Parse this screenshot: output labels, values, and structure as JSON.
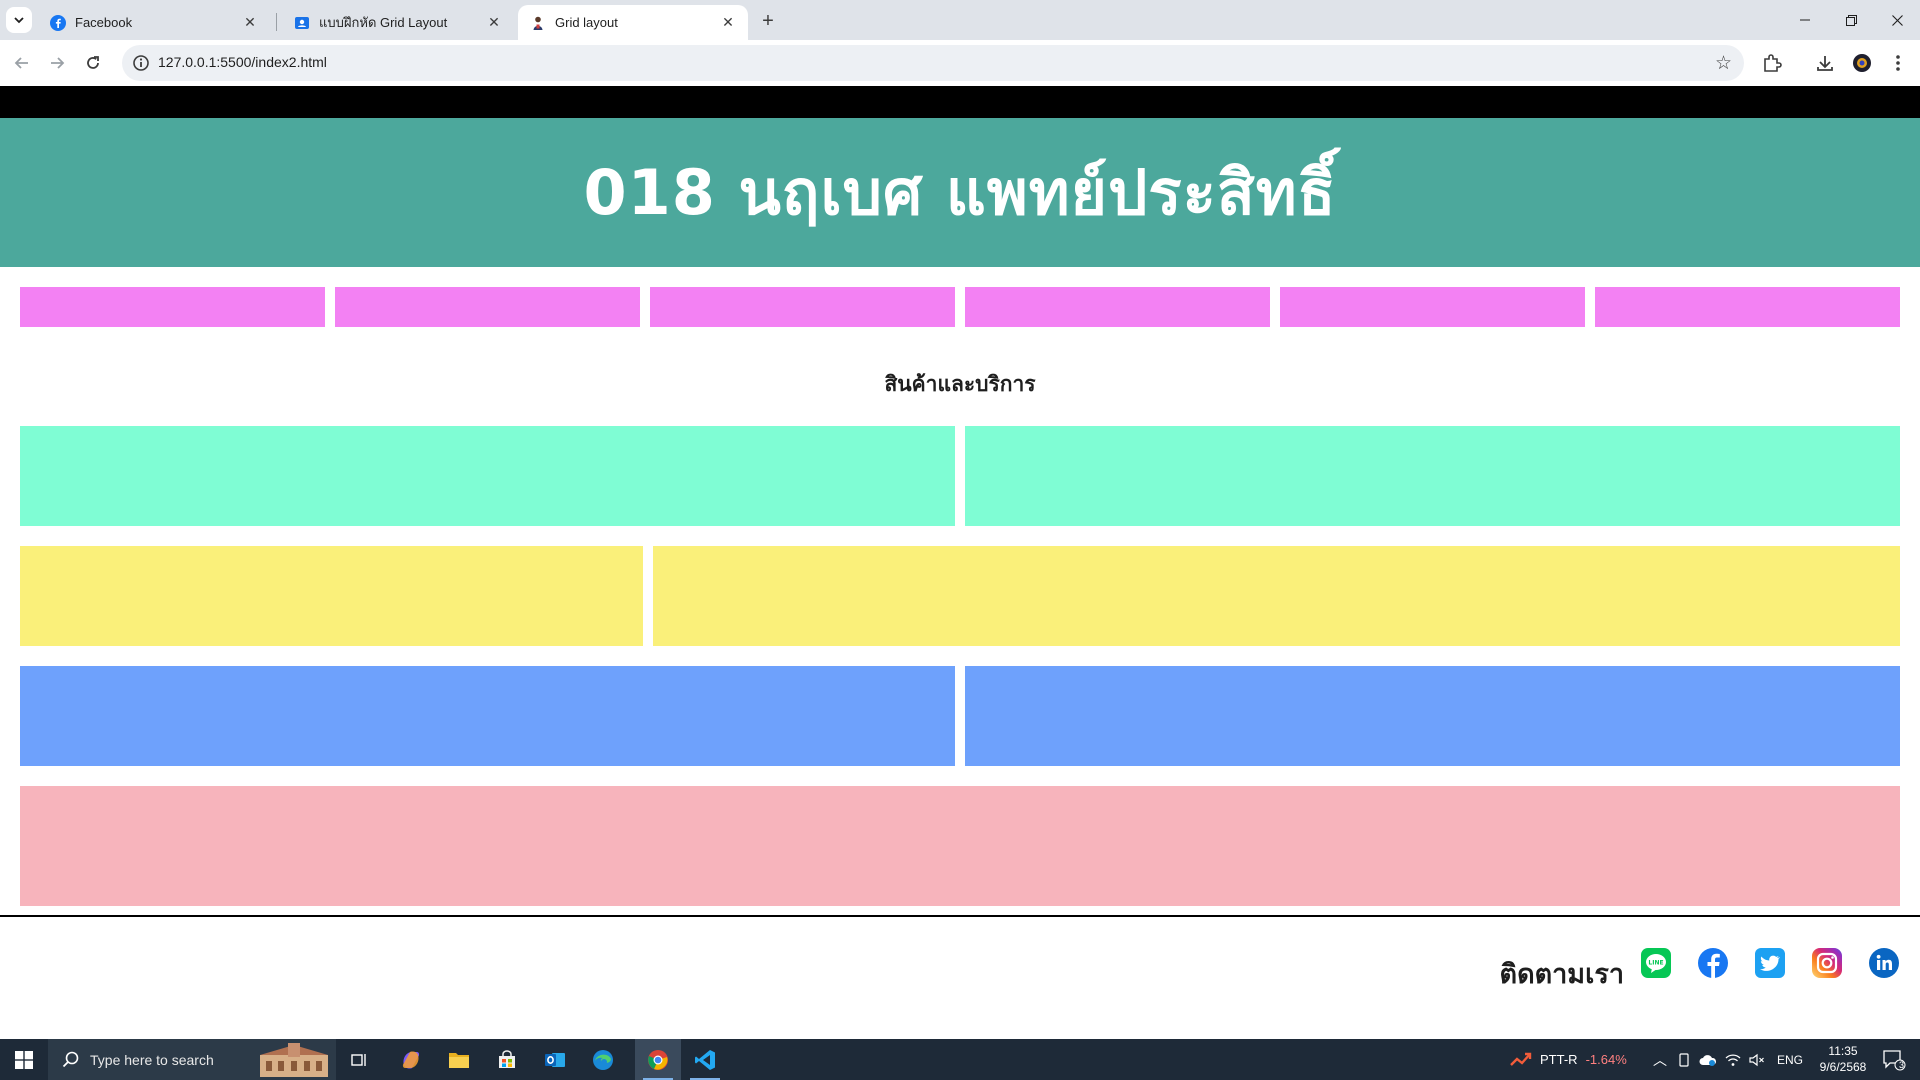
{
  "browser": {
    "tabs": [
      {
        "title": "Facebook",
        "icon": "facebook-icon"
      },
      {
        "title": "แบบฝึกหัด Grid Layout",
        "icon": "contact-card-icon"
      },
      {
        "title": "Grid layout",
        "icon": "person-icon",
        "active": true
      }
    ],
    "url": "127.0.0.1:5500/index2.html"
  },
  "page": {
    "header_title": "018 นฤเบศ แพทย์ประสิทธิ์",
    "nav_item_count": 6,
    "section_title": "สินค้าและบริการ",
    "footer": {
      "follow_label": "ติดตามเรา",
      "social": [
        "line-icon",
        "facebook-icon",
        "twitter-icon",
        "instagram-icon",
        "linkedin-icon"
      ]
    },
    "colors": {
      "header": "#4ca89c",
      "nav": "#f381f3",
      "row1": "#7ffdd4",
      "row2": "#faf07a",
      "row3": "#6ea1fc",
      "row4": "#f7b4bc"
    }
  },
  "taskbar": {
    "search_placeholder": "Type here to search",
    "stock_name": "PTT-R",
    "stock_change": "-1.64%",
    "language": "ENG",
    "time": "11:35",
    "date": "9/6/2568",
    "notification_count": "3"
  }
}
